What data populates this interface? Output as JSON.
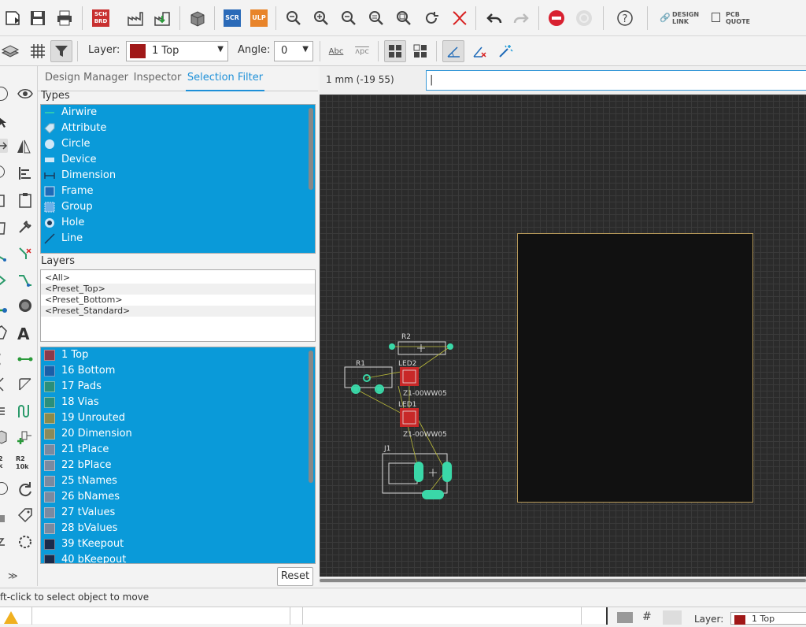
{
  "toolbar": {
    "sch_label": "SCH\nBRD",
    "scr_label": "SCR",
    "ulp_label": "ULP",
    "design_link": "DESIGN\nLINK",
    "pcb_quote": "PCB\nQUOTE",
    "layer_label": "Layer:",
    "layer_value": "1 Top",
    "angle_label": "Angle:",
    "angle_value": "0",
    "text_abc": "Abc",
    "text_vpc": "ʌpc"
  },
  "tabs": [
    "Design Manager",
    "Inspector",
    "Selection Filter"
  ],
  "types_header": "Types",
  "types": [
    {
      "label": "Airwire",
      "icon": "airwire-icon"
    },
    {
      "label": "Attribute",
      "icon": "tag-icon"
    },
    {
      "label": "Circle",
      "icon": "circle-icon"
    },
    {
      "label": "Device",
      "icon": "device-icon"
    },
    {
      "label": "Dimension",
      "icon": "dimension-icon"
    },
    {
      "label": "Frame",
      "icon": "frame-icon"
    },
    {
      "label": "Group",
      "icon": "group-icon"
    },
    {
      "label": "Hole",
      "icon": "hole-icon"
    },
    {
      "label": "Line",
      "icon": "line-icon"
    }
  ],
  "layers_header": "Layers",
  "presets": [
    "<All>",
    "<Preset_Top>",
    "<Preset_Bottom>",
    "<Preset_Standard>"
  ],
  "layers": [
    {
      "label": "1 Top",
      "color": "#8b3a4a"
    },
    {
      "label": "16 Bottom",
      "color": "#1a5fa8"
    },
    {
      "label": "17 Pads",
      "color": "#2a8f7a"
    },
    {
      "label": "18 Vias",
      "color": "#2a8f7a"
    },
    {
      "label": "19 Unrouted",
      "color": "#8a8a4a"
    },
    {
      "label": "20 Dimension",
      "color": "#8a8a5a"
    },
    {
      "label": "21 tPlace",
      "color": "#7a8aa0"
    },
    {
      "label": "22 bPlace",
      "color": "#7a8aa0"
    },
    {
      "label": "25 tNames",
      "color": "#7a8aa0"
    },
    {
      "label": "26 bNames",
      "color": "#7a8aa0"
    },
    {
      "label": "27 tValues",
      "color": "#7a8aa0"
    },
    {
      "label": "28 bValues",
      "color": "#7a8aa0"
    },
    {
      "label": "39 tKeepout",
      "color": "#1a2a4a"
    },
    {
      "label": "40 bKeepout",
      "color": "#1a2a4a"
    }
  ],
  "reset_label": "Reset",
  "coords": "1 mm (-19 55)",
  "command_value": "|",
  "board": {
    "r2": "R2",
    "r1": "R1",
    "led2": "LED2",
    "led1": "LED1",
    "led2_value": "Z1-00WW05",
    "led1_value": "Z1-00WW05",
    "j1": "J1"
  },
  "status_text": "ft-click to select object to move",
  "bottom_layer_label": "Layer:",
  "bottom_layer_value": "1 Top",
  "colors": {
    "accent": "#1e90d8",
    "list_bg": "#0a9ad9",
    "canvas": "#2b2b2b",
    "board_outline": "#b89a5a"
  }
}
